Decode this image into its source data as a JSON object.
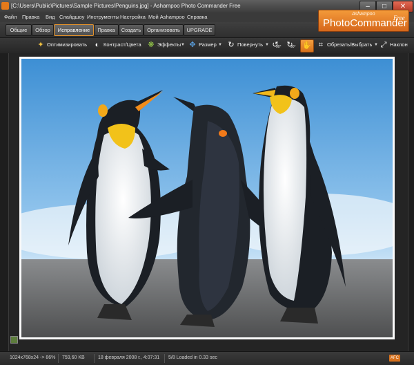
{
  "window": {
    "title": "[C:\\Users\\Public\\Pictures\\Sample Pictures\\Penguins.jpg] - Ashampoo Photo Commander Free",
    "minimize": "–",
    "maximize": "□",
    "close": "✕"
  },
  "menu": [
    "Файл",
    "Правка",
    "Вид",
    "Слайдшоу",
    "Инструменты",
    "Настройка",
    "Мой Ashampoo",
    "Справка"
  ],
  "tabs": [
    {
      "label": "Общие"
    },
    {
      "label": "Обзор"
    },
    {
      "label": "Исправление"
    },
    {
      "label": "Правка"
    },
    {
      "label": "Создать"
    },
    {
      "label": "Организовать"
    },
    {
      "label": "UPGRADE"
    }
  ],
  "active_tab": "Исправление",
  "logo": {
    "brand": "Ashampoo",
    "name": "PhotoCommander",
    "edition": "Free"
  },
  "toolbar": {
    "optimize": "Оптимизировать",
    "contrast": "Контраст/Цвета",
    "effects": "Эффекты",
    "resize": "Размер",
    "rotate": "Повернуть",
    "rotate_left": "90°",
    "rotate_right": "90°",
    "crop": "Обрезать/Выбрать",
    "tilt": "Наклон"
  },
  "status": {
    "dimensions": "1024x768x24 -> 86%",
    "filesize": "759,60 KB",
    "date": "18 февраля 2008 г., 4:07:31",
    "load": "5/8 Loaded in 0.33 sec",
    "badge": "AFC"
  },
  "colors": {
    "accent": "#e07d24",
    "background": "#2b2b2b"
  }
}
